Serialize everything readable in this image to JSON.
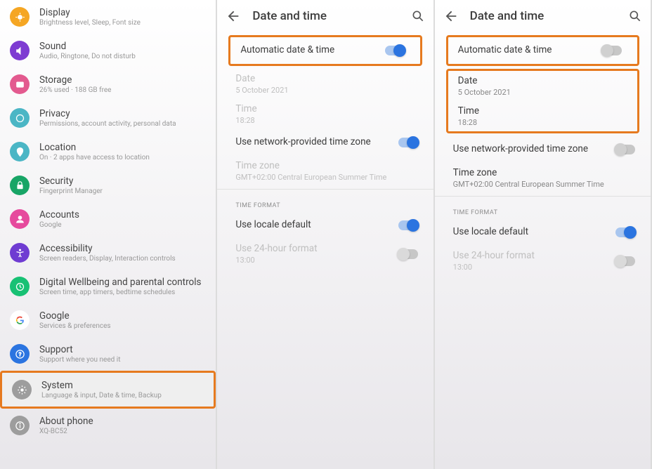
{
  "left": {
    "items": [
      {
        "id": "display",
        "title": "Display",
        "sub": "Brightness level, Sleep, Font size"
      },
      {
        "id": "sound",
        "title": "Sound",
        "sub": "Audio, Ringtone, Do not disturb"
      },
      {
        "id": "storage",
        "title": "Storage",
        "sub": "26% used · 188 GB free"
      },
      {
        "id": "privacy",
        "title": "Privacy",
        "sub": "Permissions, account activity, personal data"
      },
      {
        "id": "location",
        "title": "Location",
        "sub": "On · 2 apps have access to location"
      },
      {
        "id": "security",
        "title": "Security",
        "sub": "Fingerprint Manager"
      },
      {
        "id": "accounts",
        "title": "Accounts",
        "sub": "Google"
      },
      {
        "id": "accessibility",
        "title": "Accessibility",
        "sub": "Screen readers, Display, Interaction controls"
      },
      {
        "id": "wellbeing",
        "title": "Digital Wellbeing and parental controls",
        "sub": "Screen time, app timers, bedtime schedules"
      },
      {
        "id": "google",
        "title": "Google",
        "sub": "Services & preferences"
      },
      {
        "id": "support",
        "title": "Support",
        "sub": "Support where you need it"
      },
      {
        "id": "system",
        "title": "System",
        "sub": "Language & input, Date & time, Backup"
      },
      {
        "id": "about",
        "title": "About phone",
        "sub": "XQ-BC52"
      }
    ]
  },
  "pane_on": {
    "header": "Date and time",
    "auto_label": "Automatic date & time",
    "auto_on": true,
    "date_label": "Date",
    "date_val": "5 October 2021",
    "time_label": "Time",
    "time_val": "18:28",
    "net_tz_label": "Use network-provided time zone",
    "net_tz_on": true,
    "tz_label": "Time zone",
    "tz_val": "GMT+02:00 Central European Summer Time",
    "format_section": "TIME FORMAT",
    "locale_label": "Use locale default",
    "locale_on": true,
    "h24_label": "Use 24-hour format",
    "h24_val": "13:00"
  },
  "pane_off": {
    "header": "Date and time",
    "auto_label": "Automatic date & time",
    "auto_on": false,
    "date_label": "Date",
    "date_val": "5 October 2021",
    "time_label": "Time",
    "time_val": "18:28",
    "net_tz_label": "Use network-provided time zone",
    "net_tz_on": false,
    "tz_label": "Time zone",
    "tz_val": "GMT+02:00 Central European Summer Time",
    "format_section": "TIME FORMAT",
    "locale_label": "Use locale default",
    "locale_on": true,
    "h24_label": "Use 24-hour format",
    "h24_val": "13:00"
  }
}
